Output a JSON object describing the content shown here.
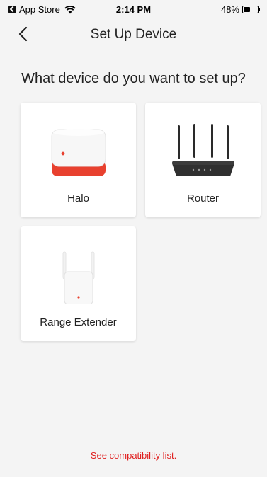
{
  "status_bar": {
    "back_app": "App Store",
    "time": "2:14 PM",
    "battery": "48%",
    "battery_level": 0.48
  },
  "nav": {
    "title": "Set Up Device"
  },
  "question": "What device do you want to set up?",
  "devices": [
    {
      "label": "Halo",
      "icon": "halo-device-icon"
    },
    {
      "label": "Router",
      "icon": "router-icon"
    },
    {
      "label": "Range Extender",
      "icon": "range-extender-icon"
    }
  ],
  "footer": {
    "link": "See compatibility list."
  },
  "colors": {
    "accent": "#e02020",
    "background": "#f4f4f4",
    "card": "#ffffff"
  }
}
